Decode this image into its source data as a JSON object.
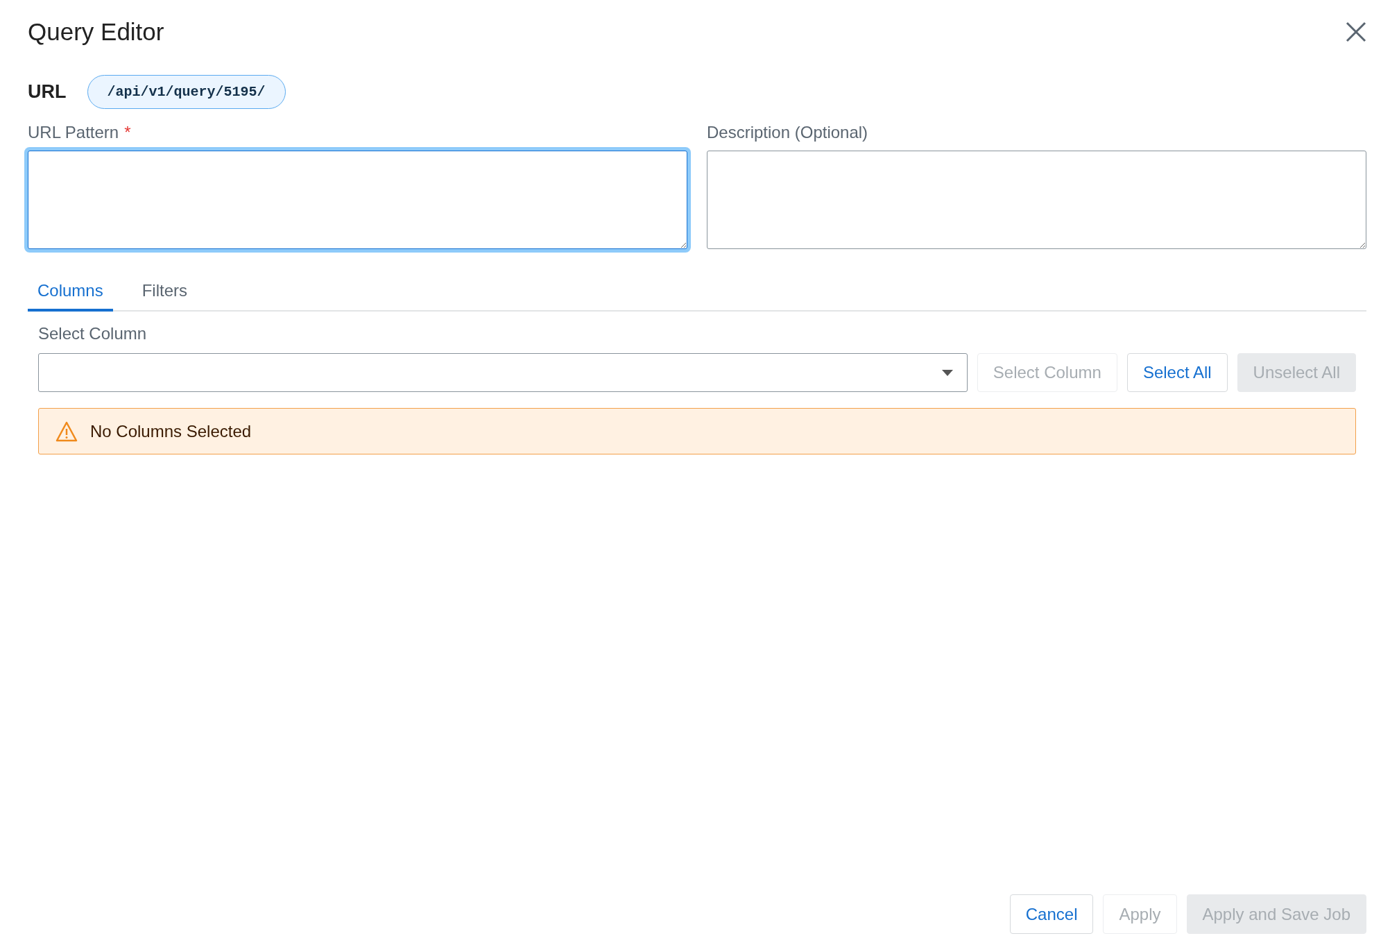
{
  "dialog": {
    "title": "Query Editor"
  },
  "url": {
    "label": "URL",
    "value": "/api/v1/query/5195/"
  },
  "required_mark": "*",
  "fields": [
    {
      "label": "URL Pattern",
      "required": true,
      "focused": true
    },
    {
      "label": "Description (Optional)",
      "required": false,
      "focused": false
    }
  ],
  "tabs": [
    {
      "label": "Columns",
      "selected": true
    },
    {
      "label": "Filters",
      "selected": false
    }
  ],
  "column_picker": {
    "label": "Select Column",
    "buttons": [
      {
        "label": "Select Column",
        "kind": "outline",
        "disabled": true
      },
      {
        "label": "Select All",
        "kind": "outline",
        "disabled": false
      },
      {
        "label": "Unselect All",
        "kind": "filled",
        "disabled": true
      }
    ]
  },
  "alert": {
    "kind": "warning",
    "text": "No Columns Selected"
  },
  "footer_buttons": [
    {
      "label": "Cancel",
      "kind": "outline",
      "disabled": false
    },
    {
      "label": "Apply",
      "kind": "outline",
      "disabled": true
    },
    {
      "label": "Apply and Save Job",
      "kind": "filled",
      "disabled": true
    }
  ]
}
